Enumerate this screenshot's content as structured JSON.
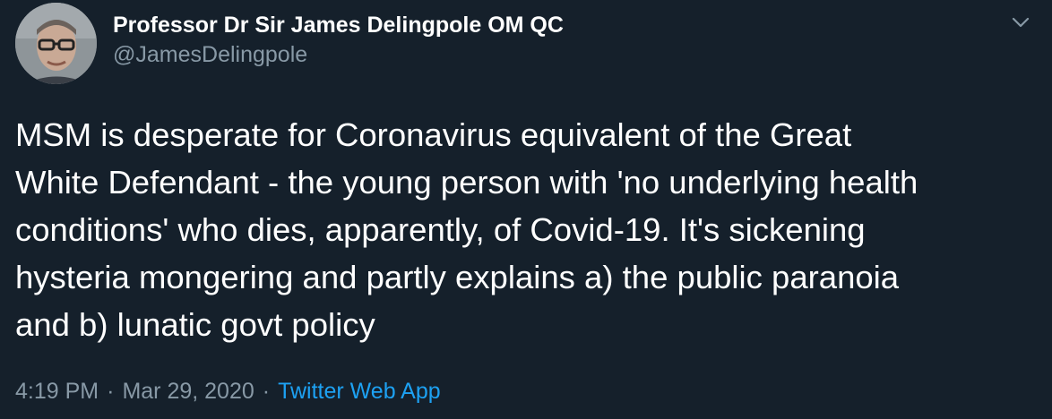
{
  "tweet": {
    "author": {
      "display_name": "Professor Dr Sir James Delingpole OM QC",
      "handle": "@JamesDelingpole"
    },
    "text_lines": [
      "MSM is desperate for Coronavirus equivalent of the Great",
      "White Defendant - the young person with 'no underlying health",
      "conditions' who dies, apparently, of Covid-19. It's sickening",
      "hysteria mongering and partly explains a) the public paranoia",
      "and b) lunatic govt policy"
    ],
    "time": "4:19 PM",
    "separator": "·",
    "date": "Mar 29, 2020",
    "source": "Twitter Web App"
  },
  "icons": {
    "menu": "chevron-down-icon"
  },
  "colors": {
    "background": "#15202b",
    "primary_text": "#ffffff",
    "secondary_text": "#8899a6",
    "link": "#1da1f2"
  }
}
